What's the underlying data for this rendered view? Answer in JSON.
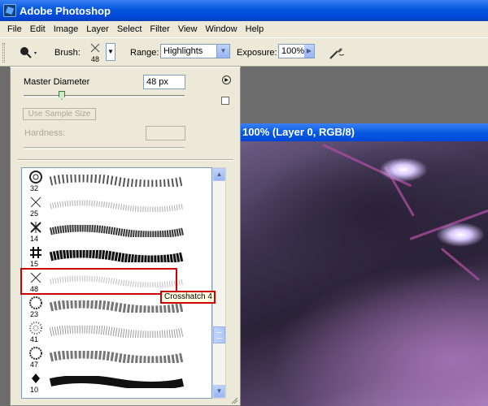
{
  "window": {
    "title": "Adobe Photoshop"
  },
  "menu": [
    "File",
    "Edit",
    "Image",
    "Layer",
    "Select",
    "Filter",
    "View",
    "Window",
    "Help"
  ],
  "options": {
    "brush_label": "Brush:",
    "brush_size": "48",
    "range_label": "Range:",
    "range_value": "Highlights",
    "exposure_label": "Exposure:",
    "exposure_value": "100%"
  },
  "brush_panel": {
    "master_diameter_label": "Master Diameter",
    "master_diameter_value": "48 px",
    "master_diameter_level": 0.29,
    "use_sample_size": "Use Sample Size",
    "hardness_label": "Hardness:",
    "hardness_value": "",
    "brushes": [
      {
        "size": "32",
        "icon": "ring-brush",
        "stroke": "rings"
      },
      {
        "size": "25",
        "icon": "crosshatch-brush",
        "stroke": "light-hatch"
      },
      {
        "size": "14",
        "icon": "crosshatch-brush",
        "stroke": "dense-hatch"
      },
      {
        "size": "15",
        "icon": "hash-brush",
        "stroke": "heavy-hatch"
      },
      {
        "size": "48",
        "icon": "crosshatch-brush",
        "stroke": "light-hatch",
        "selected": true
      },
      {
        "size": "23",
        "icon": "dotted-ring-brush",
        "stroke": "rings"
      },
      {
        "size": "41",
        "icon": "star-burst-brush",
        "stroke": "light-rings"
      },
      {
        "size": "47",
        "icon": "dotted-ring-brush",
        "stroke": "rings"
      },
      {
        "size": "10",
        "icon": "diamond-brush",
        "stroke": "solid"
      }
    ],
    "tooltip": "Crosshatch 4"
  },
  "document": {
    "title": "100% (Layer 0, RGB/8)"
  }
}
